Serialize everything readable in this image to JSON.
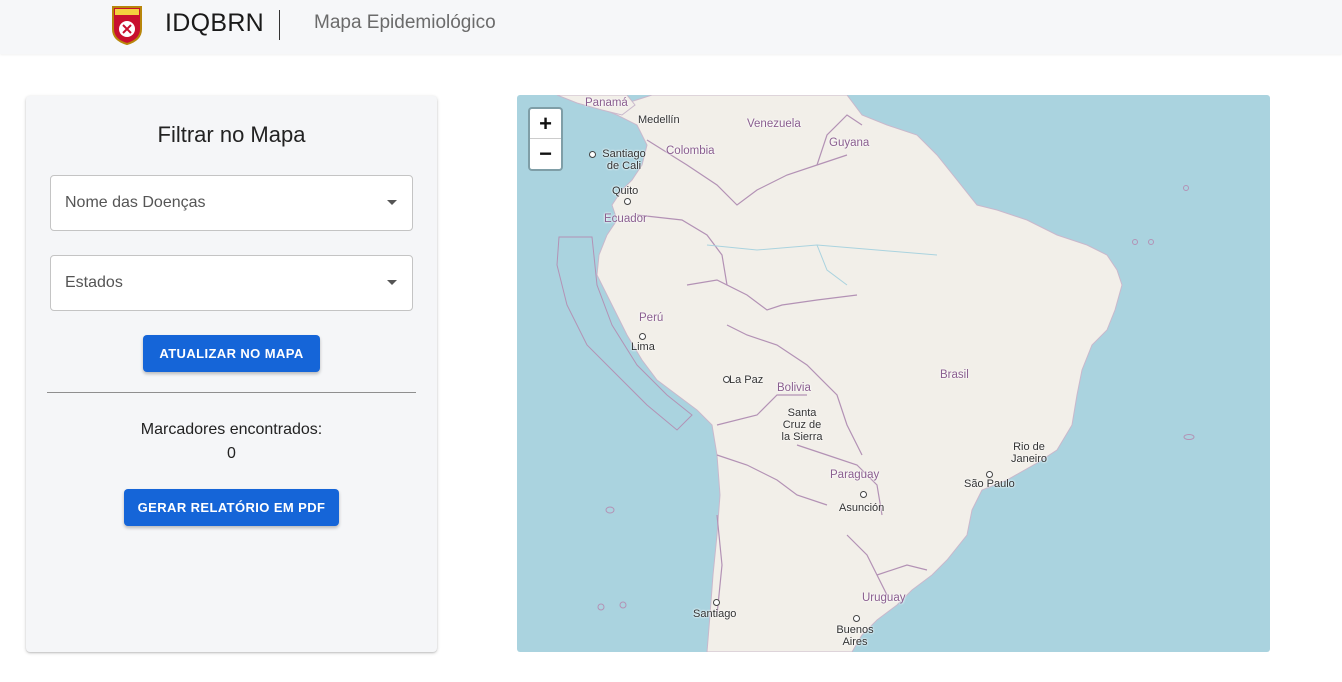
{
  "header": {
    "brand": "IDQBRN",
    "subtitle": "Mapa Epidemiológico",
    "logo_text": "IDQBRN"
  },
  "filter_panel": {
    "title": "Filtrar no Mapa",
    "disease_select": {
      "placeholder": "Nome das Doenças"
    },
    "state_select": {
      "placeholder": "Estados"
    },
    "update_button": "ATUALIZAR NO MAPA",
    "markers_label": "Marcadores encontrados:",
    "markers_count": "0",
    "pdf_button": "GERAR RELATÓRIO EM PDF"
  },
  "map": {
    "zoom_in": "+",
    "zoom_out": "−",
    "countries": {
      "panama": "Panamá",
      "venezuela": "Venezuela",
      "colombia": "Colombia",
      "guyana": "Guyana",
      "ecuador": "Ecuador",
      "peru": "Perú",
      "bolivia": "Bolivia",
      "brasil": "Brasil",
      "paraguay": "Paraguay",
      "uruguay": "Uruguay"
    },
    "cities": {
      "medellin": "Medellín",
      "cali": "Santiago de Cali",
      "quito": "Quito",
      "lima": "Lima",
      "lapaz": "La Paz",
      "santacruz": "Santa Cruz de la Sierra",
      "asuncion": "Asunción",
      "rio": "Rio de Janeiro",
      "saopaulo": "São Paulo",
      "santiago": "Santiago",
      "buenosaires": "Buenos Aires"
    },
    "colors": {
      "water": "#aad3df",
      "land": "#f2efe9",
      "border": "#b392b5"
    }
  },
  "colors": {
    "accent": "#1565d8",
    "panel_bg": "#f5f6f8",
    "topbar_bg": "#f6f7f9"
  }
}
